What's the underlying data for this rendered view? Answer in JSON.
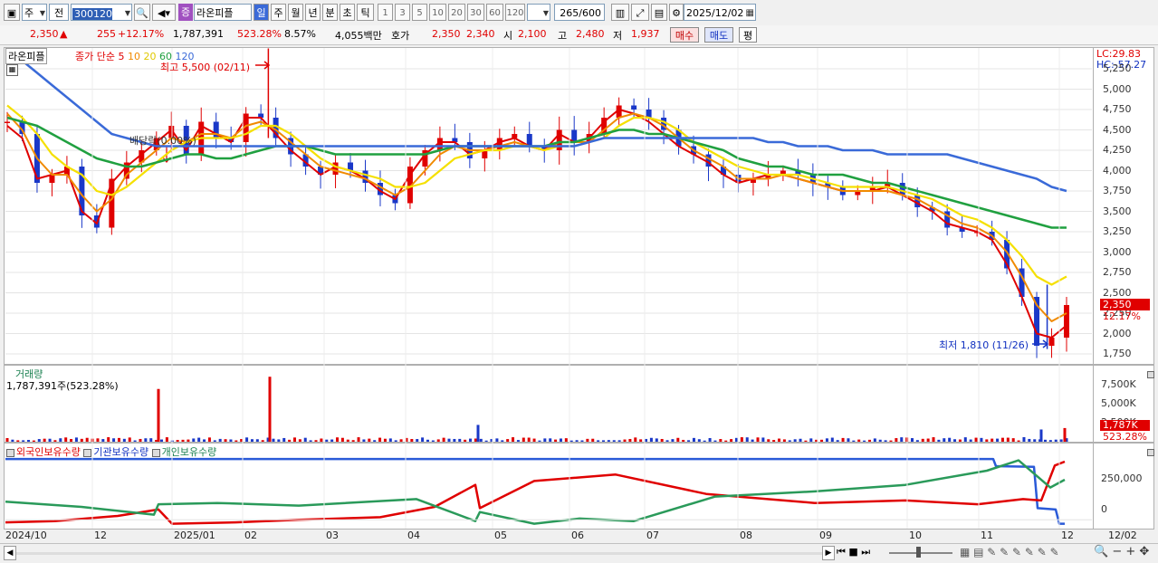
{
  "toolbar": {
    "market": "주",
    "prev_label": "전",
    "code": "300120",
    "stock_name": "라온피플",
    "badge": "증",
    "periods": [
      "일",
      "주",
      "월",
      "년",
      "분",
      "초",
      "틱"
    ],
    "intervals": [
      "1",
      "3",
      "5",
      "10",
      "20",
      "30",
      "60",
      "120"
    ],
    "count": "265",
    "count_max": "/600",
    "date": "2025/12/02"
  },
  "quote": {
    "price": "2,350",
    "change": "255",
    "change_pct": "+12.17%",
    "volume": "1,787,391",
    "vol_ratio": "523.28%",
    "turnover": "8.57%",
    "amount": "4,055백만",
    "bid_label": "호가",
    "bid": "2,350",
    "ask": "2,340",
    "open_label": "시",
    "open": "2,100",
    "high_label": "고",
    "high": "2,480",
    "low_label": "저",
    "low": "1,937",
    "buy": "매수",
    "sell": "매도",
    "eval": "평"
  },
  "price_panel": {
    "name": "라온피플",
    "legend_prefix": "종가 단순",
    "ma_periods": [
      "5",
      "10",
      "20",
      "60",
      "120"
    ],
    "high_note": "최고 5,500 (02/11)",
    "low_note": "최저 1,810 (11/26)",
    "dividend_note": "배당락(0.00%)",
    "lc": "LC:29.83",
    "hc": "HC:-57.27",
    "yaxis": [
      "5,250",
      "5,000",
      "4,750",
      "4,500",
      "4,250",
      "4,000",
      "3,750",
      "3,500",
      "3,250",
      "3,000",
      "2,750",
      "2,500",
      "2,250",
      "2,000",
      "1,750"
    ],
    "price_tag": "2,350",
    "pct_tag": "12.17%"
  },
  "volume_panel": {
    "title": "거래량",
    "value": "1,787,391주(523.28%)",
    "yaxis": [
      "7,500K",
      "5,000K",
      "2,500K"
    ],
    "tag": "1,787K",
    "pct": "523.28%"
  },
  "holdings_panel": {
    "legends": [
      "외국인보유수량",
      "기관보유수량",
      "개인보유수량"
    ],
    "yaxis": [
      "250,000",
      "0"
    ]
  },
  "xaxis": [
    "2024/10",
    "12",
    "2025/01",
    "02",
    "03",
    "04",
    "05",
    "06",
    "07",
    "08",
    "09",
    "10",
    "11",
    "12",
    "12/02"
  ],
  "colors": {
    "up": "#e00000",
    "down": "#1a38c8",
    "ma5": "#e00000",
    "ma10": "#f08a00",
    "ma20": "#f5e000",
    "ma60": "#20a040",
    "ma120": "#3a6ad8"
  },
  "chart_data": [
    {
      "type": "candlestick",
      "title": "라온피플",
      "x": [
        "2024/10",
        "12",
        "2025/01",
        "02",
        "03",
        "04",
        "05",
        "06",
        "07",
        "08",
        "09",
        "10",
        "11",
        "12"
      ],
      "close_series": [
        4600,
        4450,
        3850,
        3950,
        4050,
        3450,
        3300,
        3900,
        4100,
        4250,
        4400,
        4550,
        4200,
        4600,
        4400,
        4350,
        4700,
        4650,
        4400,
        4200,
        4050,
        3950,
        4100,
        4000,
        3850,
        3700,
        3600,
        4050,
        4250,
        4400,
        4350,
        4150,
        4250,
        4400,
        4450,
        4300,
        4250,
        4500,
        4350,
        4450,
        4650,
        4800,
        4750,
        4650,
        4500,
        4300,
        4200,
        4050,
        3950,
        3850,
        3900,
        3950,
        4000,
        3950,
        3850,
        3800,
        3700,
        3750,
        3800,
        3850,
        3700,
        3550,
        3500,
        3300,
        3250,
        3250,
        3150,
        2800,
        2450,
        1850,
        1950,
        2350
      ],
      "yaxis_range": [
        1650,
        5450
      ],
      "high": {
        "value": 5500,
        "label": "최고 5,500 (02/11)"
      },
      "low": {
        "value": 1810,
        "label": "최저 1,810 (11/26)"
      },
      "legend": [
        "종가 단순 5",
        "10",
        "20",
        "60",
        "120"
      ],
      "series": [
        {
          "name": "5",
          "values": [
            4550,
            4400,
            3900,
            3950,
            4000,
            3500,
            3350,
            3850,
            4050,
            4200,
            4350,
            4500,
            4250,
            4550,
            4450,
            4350,
            4650,
            4650,
            4450,
            4250,
            4100,
            3950,
            4050,
            4000,
            3900,
            3750,
            3650,
            3950,
            4200,
            4350,
            4350,
            4200,
            4250,
            4350,
            4400,
            4300,
            4250,
            4450,
            4350,
            4400,
            4600,
            4750,
            4700,
            4600,
            4450,
            4300,
            4200,
            4100,
            3950,
            3850,
            3900,
            3950,
            3950,
            3900,
            3850,
            3800,
            3750,
            3750,
            3750,
            3800,
            3700,
            3600,
            3500,
            3350,
            3300,
            3250,
            3150,
            2850,
            2450,
            2000,
            1950,
            2100
          ]
        },
        {
          "name": "10",
          "values": [
            4700,
            4500,
            4150,
            3950,
            3950,
            3700,
            3500,
            3650,
            3950,
            4100,
            4250,
            4400,
            4350,
            4450,
            4450,
            4400,
            4550,
            4600,
            4500,
            4350,
            4200,
            4050,
            4000,
            3950,
            3900,
            3800,
            3700,
            3800,
            4000,
            4200,
            4300,
            4250,
            4250,
            4300,
            4350,
            4300,
            4250,
            4350,
            4350,
            4350,
            4500,
            4650,
            4700,
            4650,
            4550,
            4400,
            4250,
            4150,
            4050,
            3900,
            3900,
            3900,
            3950,
            3900,
            3850,
            3800,
            3750,
            3750,
            3750,
            3750,
            3700,
            3650,
            3550,
            3450,
            3350,
            3300,
            3200,
            3000,
            2700,
            2350,
            2150,
            2250
          ]
        },
        {
          "name": "20",
          "values": [
            4800,
            4650,
            4450,
            4200,
            4050,
            3950,
            3750,
            3700,
            3800,
            3950,
            4100,
            4250,
            4350,
            4400,
            4400,
            4400,
            4450,
            4550,
            4550,
            4450,
            4300,
            4150,
            4050,
            4000,
            3950,
            3900,
            3800,
            3800,
            3850,
            4000,
            4150,
            4200,
            4250,
            4250,
            4300,
            4300,
            4250,
            4300,
            4300,
            4350,
            4400,
            4550,
            4650,
            4650,
            4600,
            4500,
            4350,
            4250,
            4150,
            4050,
            4000,
            3950,
            3950,
            3950,
            3900,
            3850,
            3800,
            3800,
            3800,
            3800,
            3750,
            3700,
            3650,
            3550,
            3450,
            3400,
            3300,
            3150,
            2950,
            2700,
            2600,
            2700
          ]
        },
        {
          "name": "60",
          "values": [
            4650,
            4600,
            4550,
            4450,
            4350,
            4250,
            4150,
            4100,
            4050,
            4050,
            4100,
            4150,
            4200,
            4200,
            4150,
            4150,
            4200,
            4250,
            4300,
            4300,
            4300,
            4250,
            4200,
            4200,
            4200,
            4200,
            4200,
            4200,
            4200,
            4250,
            4300,
            4300,
            4300,
            4300,
            4300,
            4300,
            4300,
            4350,
            4350,
            4400,
            4450,
            4500,
            4500,
            4450,
            4450,
            4400,
            4350,
            4300,
            4250,
            4150,
            4100,
            4050,
            4050,
            4000,
            3950,
            3950,
            3950,
            3900,
            3850,
            3850,
            3800,
            3750,
            3700,
            3650,
            3600,
            3550,
            3500,
            3450,
            3400,
            3350,
            3300,
            3300
          ]
        },
        {
          "name": "120",
          "values": [
            5450,
            5350,
            5200,
            5050,
            4900,
            4750,
            4600,
            4450,
            4400,
            4350,
            4300,
            4300,
            4300,
            4300,
            4300,
            4300,
            4300,
            4300,
            4300,
            4300,
            4300,
            4300,
            4300,
            4300,
            4300,
            4300,
            4300,
            4300,
            4300,
            4300,
            4300,
            4300,
            4300,
            4300,
            4300,
            4300,
            4300,
            4300,
            4300,
            4350,
            4400,
            4400,
            4400,
            4400,
            4400,
            4400,
            4400,
            4400,
            4400,
            4400,
            4400,
            4350,
            4350,
            4300,
            4300,
            4300,
            4250,
            4250,
            4250,
            4200,
            4200,
            4200,
            4200,
            4200,
            4150,
            4100,
            4050,
            4000,
            3950,
            3900,
            3800,
            3750
          ]
        }
      ]
    },
    {
      "type": "bar",
      "title": "거래량",
      "yaxis": [
        "7,500K",
        "5,000K",
        "2,500K"
      ],
      "last": {
        "value": 1787391,
        "label": "1,787,391주(523.28%)"
      },
      "spikes": [
        {
          "x": "12",
          "value": 6900
        },
        {
          "x": "02",
          "value": 8500
        },
        {
          "x": "05",
          "value": 2200
        },
        {
          "x": "11",
          "value": 1600
        },
        {
          "x": "12",
          "value": 1787
        }
      ]
    },
    {
      "type": "line",
      "title": "보유수량",
      "yaxis": [
        "250,000",
        "0"
      ],
      "series": [
        {
          "name": "외국인보유수량",
          "trend": "low → high (ends near 450,000)"
        },
        {
          "name": "기관보유수량",
          "trend": "flat near 450,000 then drops below 0 at 12"
        },
        {
          "name": "개인보유수량",
          "trend": "mid, dips mid-year, ends near 300,000"
        }
      ]
    }
  ]
}
